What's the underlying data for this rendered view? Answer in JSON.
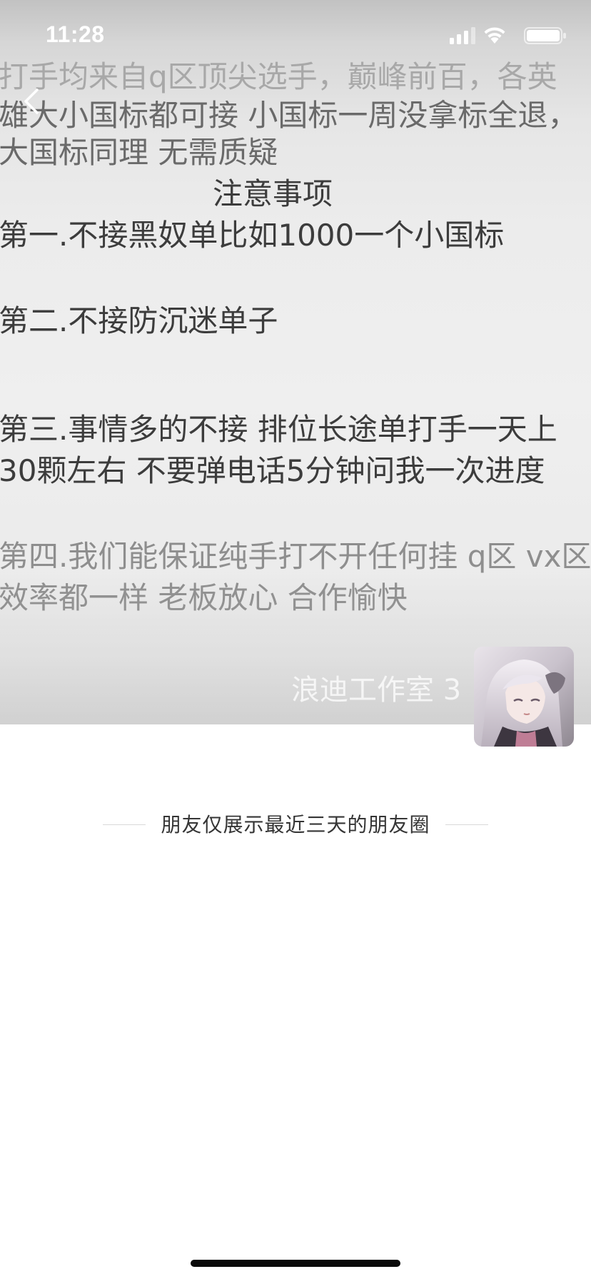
{
  "status_bar": {
    "time": "11:28",
    "icons": [
      "signal-icon",
      "wifi-icon",
      "battery-icon"
    ]
  },
  "navigation": {
    "back_icon": "chevron-left-icon"
  },
  "cover_image": {
    "lines": [
      "打手均来自q区顶尖选手，巅峰前百，各英",
      "雄大小国标都可接 小国标一周没拿标全退，",
      "大国标同理 无需质疑",
      "注意事项",
      "第一.不接黑奴单比如1000一个小国标",
      "第二.不接防沉迷单子",
      "第三.事情多的不接 排位长途单打手一天上",
      "30颗左右 不要弹电话5分钟问我一次进度",
      "第四.我们能保证纯手打不开任何挂 q区 vx区",
      "效率都一样 老板放心 合作愉快"
    ],
    "watermark": "浪迪工作室 3"
  },
  "profile": {
    "avatar_icon": "avatar-image"
  },
  "recent_notice": "朋友仅展示最近三天的朋友圈",
  "colors": {
    "background": "#ffffff",
    "notice_text": "#353535",
    "divider": "#d9d9d9",
    "home_indicator": "#0a0a0a"
  }
}
